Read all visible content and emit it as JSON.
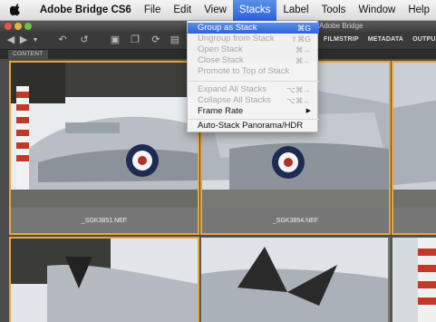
{
  "menubar": {
    "apple_icon": "apple-icon",
    "items": [
      "Adobe Bridge CS6",
      "File",
      "Edit",
      "View",
      "Stacks",
      "Label",
      "Tools",
      "Window",
      "Help"
    ]
  },
  "window": {
    "title": "Adobe Bridge",
    "workspaces": [
      "FILMSTRIP",
      "METADATA",
      "OUTPUT"
    ],
    "panel_tab": "CONTENT"
  },
  "toolbar": {
    "icons": [
      "back-arrow-icon",
      "forward-arrow-icon",
      "dropdown-icon",
      "recent-folder-icon",
      "boomerang-icon",
      "camera-download-icon",
      "copy-icon",
      "rotate-icon",
      "refine-icon"
    ]
  },
  "stacks_menu": {
    "items": [
      {
        "label": "Group as Stack",
        "shortcut": "⌘G",
        "state": "highlighted"
      },
      {
        "label": "Ungroup from Stack",
        "shortcut": "⇧⌘G",
        "state": "disabled"
      },
      {
        "label": "Open Stack",
        "shortcut": "⌘→",
        "state": "disabled"
      },
      {
        "label": "Close Stack",
        "shortcut": "⌘←",
        "state": "disabled"
      },
      {
        "label": "Promote to Top of Stack",
        "shortcut": "",
        "state": "disabled"
      },
      {
        "label": "Expand All Stacks",
        "shortcut": "⌥⌘→",
        "state": "disabled"
      },
      {
        "label": "Collapse All Stacks",
        "shortcut": "⌥⌘←",
        "state": "disabled"
      },
      {
        "label": "Frame Rate",
        "shortcut": "",
        "state": "enabled",
        "submenu": true
      },
      {
        "label": "Auto-Stack Panorama/HDR",
        "shortcut": "",
        "state": "enabled"
      }
    ]
  },
  "thumbnails": [
    {
      "filename": "_SGK3851.NEF",
      "selected": true
    },
    {
      "filename": "_SGK3854.NEF",
      "selected": true
    },
    {
      "filename": "",
      "selected": false
    },
    {
      "filename": "",
      "selected": true
    },
    {
      "filename": "",
      "selected": false
    },
    {
      "filename": "",
      "selected": false
    }
  ],
  "colors": {
    "selection": "#e7a53e",
    "menu_highlight": "#2f63d6",
    "content_bg": "#4c4c4c"
  }
}
